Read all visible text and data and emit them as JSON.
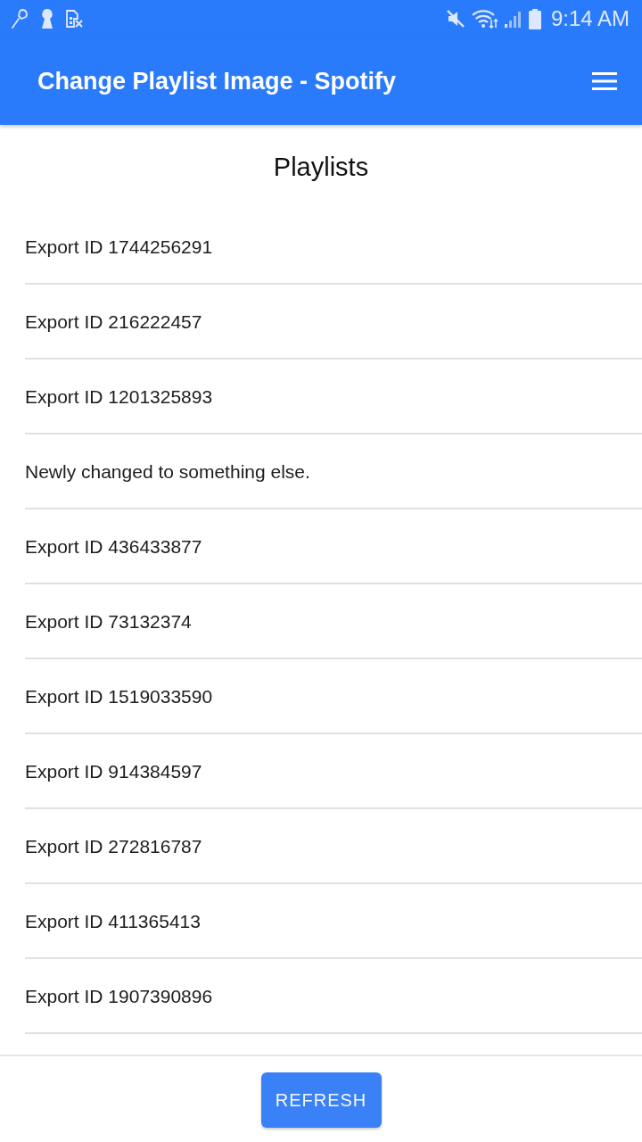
{
  "status_bar": {
    "time": "9:14 AM"
  },
  "app_bar": {
    "title": "Change Playlist Image - Spotify"
  },
  "heading": "Playlists",
  "playlists": [
    {
      "name": "Export ID 1744256291"
    },
    {
      "name": "Export ID 216222457"
    },
    {
      "name": "Export ID 1201325893"
    },
    {
      "name": "Newly changed to something else."
    },
    {
      "name": "Export ID 436433877"
    },
    {
      "name": "Export ID 73132374"
    },
    {
      "name": "Export ID 1519033590"
    },
    {
      "name": "Export ID 914384597"
    },
    {
      "name": "Export ID 272816787"
    },
    {
      "name": "Export ID 411365413"
    },
    {
      "name": "Export ID 1907390896"
    }
  ],
  "footer": {
    "button": "REFRESH"
  }
}
